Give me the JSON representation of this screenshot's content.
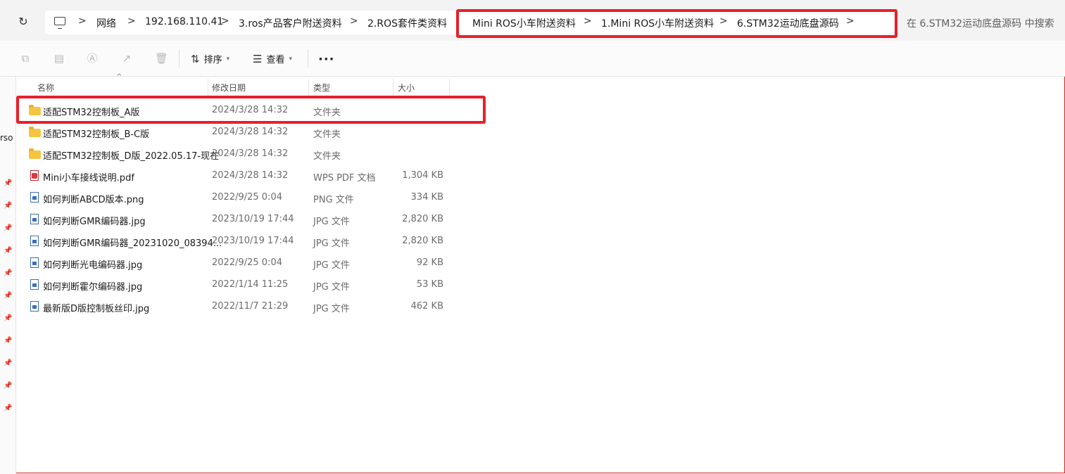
{
  "address": {
    "crumbs": [
      "网络",
      "192.168.110.41",
      "3.ros产品客户附送资料",
      "2.ROS套件类资料",
      "Mini ROS小车附送资料",
      "1.Mini ROS小车附送资料",
      "6.STM32运动底盘源码"
    ],
    "separator": ">",
    "search_placeholder": "在 6.STM32运动底盘源码 中搜索"
  },
  "toolbar": {
    "sort_label": "排序",
    "view_label": "查看",
    "more_label": "···"
  },
  "columns": {
    "name": "名称",
    "date": "修改日期",
    "type": "类型",
    "size": "大小"
  },
  "files": [
    {
      "name": "适配STM32控制板_A版",
      "date": "2024/3/28 14:32",
      "type": "文件夹",
      "size": "",
      "kind": "folder"
    },
    {
      "name": "适配STM32控制板_B-C版",
      "date": "2024/3/28 14:32",
      "type": "文件夹",
      "size": "",
      "kind": "folder"
    },
    {
      "name": "适配STM32控制板_D版_2022.05.17-现在",
      "date": "2024/3/28 14:32",
      "type": "文件夹",
      "size": "",
      "kind": "folder"
    },
    {
      "name": "Mini小车接线说明.pdf",
      "date": "2024/3/28 14:32",
      "type": "WPS PDF 文档",
      "size": "1,304 KB",
      "kind": "pdf"
    },
    {
      "name": "如何判断ABCD版本.png",
      "date": "2022/9/25 0:04",
      "type": "PNG 文件",
      "size": "334 KB",
      "kind": "image"
    },
    {
      "name": "如何判断GMR编码器.jpg",
      "date": "2023/10/19 17:44",
      "type": "JPG 文件",
      "size": "2,820 KB",
      "kind": "image"
    },
    {
      "name": "如何判断GMR编码器_20231020_08394...",
      "date": "2023/10/19 17:44",
      "type": "JPG 文件",
      "size": "2,820 KB",
      "kind": "image"
    },
    {
      "name": "如何判断光电编码器.jpg",
      "date": "2022/9/25 0:04",
      "type": "JPG 文件",
      "size": "92 KB",
      "kind": "image"
    },
    {
      "name": "如何判断霍尔编码器.jpg",
      "date": "2022/1/14 11:25",
      "type": "JPG 文件",
      "size": "53 KB",
      "kind": "image"
    },
    {
      "name": "最新版D版控制板丝印.jpg",
      "date": "2022/11/7 21:29",
      "type": "JPG 文件",
      "size": "462 KB",
      "kind": "image"
    }
  ],
  "sidebar_fragment": "rso",
  "colors": {
    "highlight": "#e8202a",
    "folder": "#f5c542"
  }
}
